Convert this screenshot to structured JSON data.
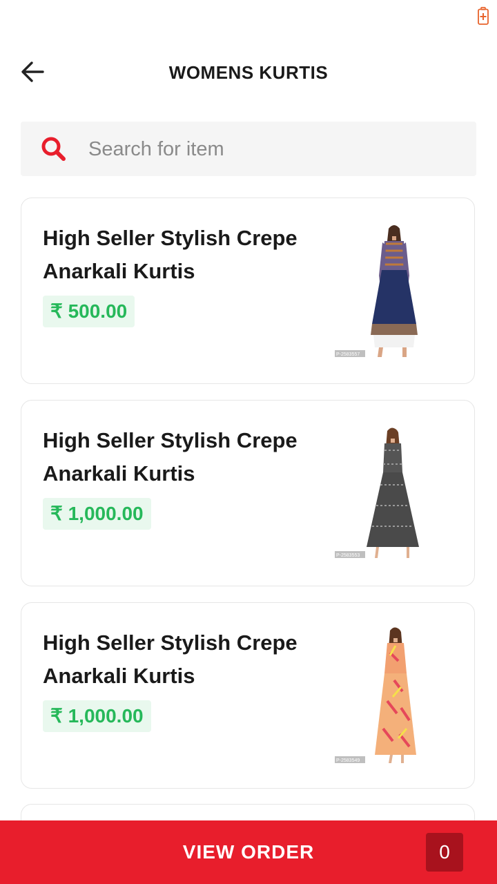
{
  "status_bar": {
    "battery_icon": "battery-charging-icon",
    "accent": "#e8622a"
  },
  "header": {
    "back_icon": "arrow-left-icon",
    "title": "WOMENS KURTIS"
  },
  "search": {
    "icon": "search-icon",
    "placeholder": "Search for item",
    "value": ""
  },
  "products": [
    {
      "title": "High Seller Stylish Crepe Anarkali Kurtis",
      "price": "₹ 500.00",
      "image_code": "P-2583557"
    },
    {
      "title": "High Seller Stylish Crepe Anarkali Kurtis",
      "price": "₹ 1,000.00",
      "image_code": "P-2583553"
    },
    {
      "title": "High Seller Stylish Crepe Anarkali Kurtis",
      "price": "₹ 1,000.00",
      "image_code": "P-2583549"
    }
  ],
  "footer": {
    "label": "VIEW ORDER",
    "count": "0"
  },
  "colors": {
    "brand_red": "#e81e2c",
    "count_badge": "#a8121d",
    "price_green": "#26b85a",
    "price_bg": "#e9f8ee"
  }
}
